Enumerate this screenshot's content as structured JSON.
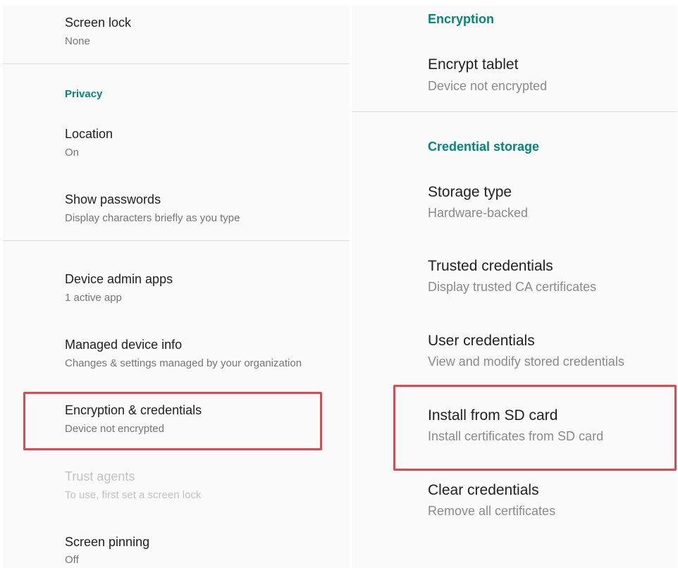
{
  "left": {
    "screen_lock": {
      "title": "Screen lock",
      "summary": "None"
    },
    "privacy_header": "Privacy",
    "location": {
      "title": "Location",
      "summary": "On"
    },
    "show_passwords": {
      "title": "Show passwords",
      "summary": "Display characters briefly as you type"
    },
    "device_admin": {
      "title": "Device admin apps",
      "summary": "1 active app"
    },
    "managed_info": {
      "title": "Managed device info",
      "summary": "Changes & settings managed by your organization"
    },
    "encryption_credentials": {
      "title": "Encryption & credentials",
      "summary": "Device not encrypted"
    },
    "trust_agents": {
      "title": "Trust agents",
      "summary": "To use, first set a screen lock"
    },
    "screen_pinning": {
      "title": "Screen pinning",
      "summary": "Off"
    }
  },
  "right": {
    "encryption_header": "Encryption",
    "encrypt_tablet": {
      "title": "Encrypt tablet",
      "summary": "Device not encrypted"
    },
    "credential_header": "Credential storage",
    "storage_type": {
      "title": "Storage type",
      "summary": "Hardware-backed"
    },
    "trusted_credentials": {
      "title": "Trusted credentials",
      "summary": "Display trusted CA certificates"
    },
    "user_credentials": {
      "title": "User credentials",
      "summary": "View and modify stored credentials"
    },
    "install_sd": {
      "title": "Install from SD card",
      "summary": "Install certificates from SD card"
    },
    "clear_credentials": {
      "title": "Clear credentials",
      "summary": "Remove all certificates"
    }
  },
  "colors": {
    "accent": "#00897b",
    "highlight": "#dc4a4f",
    "title": "#212121",
    "summary": "#757575"
  }
}
